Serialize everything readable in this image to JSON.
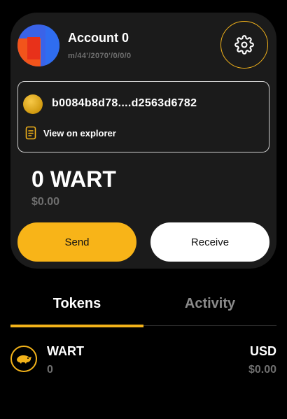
{
  "colors": {
    "accent": "#f3b31a",
    "background": "#000000",
    "card": "#1b1b1b",
    "muted_text": "#6f6f6f"
  },
  "account": {
    "name": "Account 0",
    "derivation_path": "m/44'/2070'/0/0/0",
    "avatar_icon": "jazzicon-avatar",
    "settings_icon": "gear-icon"
  },
  "address": {
    "coin_icon": "coin-icon",
    "value": "b0084b8d78....d2563d6782",
    "explorer_icon": "document-icon",
    "explorer_label": "View on explorer"
  },
  "balance": {
    "amount": "0 WART",
    "fiat": "$0.00"
  },
  "actions": {
    "send_label": "Send",
    "receive_label": "Receive"
  },
  "tabs": {
    "active": "Tokens",
    "items": [
      {
        "label": "Tokens"
      },
      {
        "label": "Activity"
      }
    ]
  },
  "tokens": [
    {
      "icon": "warthog-icon",
      "symbol": "WART",
      "amount": "0",
      "currency": "USD",
      "fiat_value": "$0.00"
    }
  ]
}
